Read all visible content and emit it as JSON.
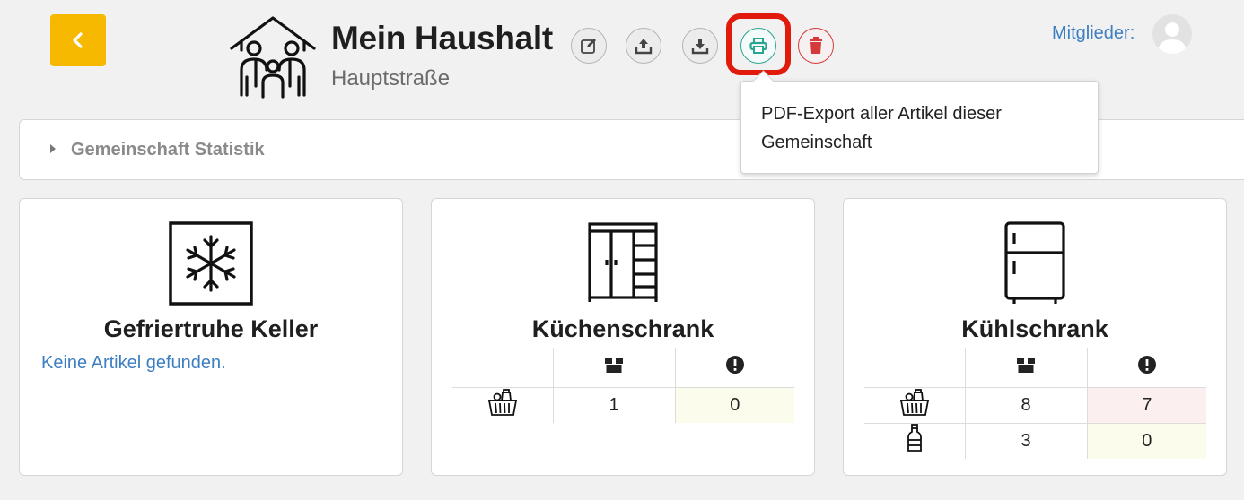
{
  "header": {
    "title": "Mein Haushalt",
    "subtitle": "Hauptstraße",
    "members_label": "Mitglieder:"
  },
  "actions": {
    "tooltip": "PDF-Export aller Artikel dieser Gemeinschaft"
  },
  "stats": {
    "label": "Gemeinschaft Statistik"
  },
  "colors": {
    "accent": "#f7b900",
    "link": "#3d7fc1",
    "print": "#2aa592",
    "delete": "#d43a3a",
    "highlight": "#e01b0c"
  },
  "storages": [
    {
      "name": "Gefriertruhe Keller",
      "icon": "snowflake-icon",
      "empty_text": "Keine Artikel gefunden."
    },
    {
      "name": "Küchenschrank",
      "icon": "cabinet-icon",
      "rows": [
        {
          "icon": "grocery-basket-icon",
          "count": "1",
          "warnings": "0",
          "status": "ok"
        }
      ]
    },
    {
      "name": "Kühlschrank",
      "icon": "fridge-icon",
      "rows": [
        {
          "icon": "grocery-basket-icon",
          "count": "8",
          "warnings": "7",
          "status": "bad"
        },
        {
          "icon": "bottle-icon",
          "count": "3",
          "warnings": "0",
          "status": "ok"
        }
      ]
    }
  ]
}
